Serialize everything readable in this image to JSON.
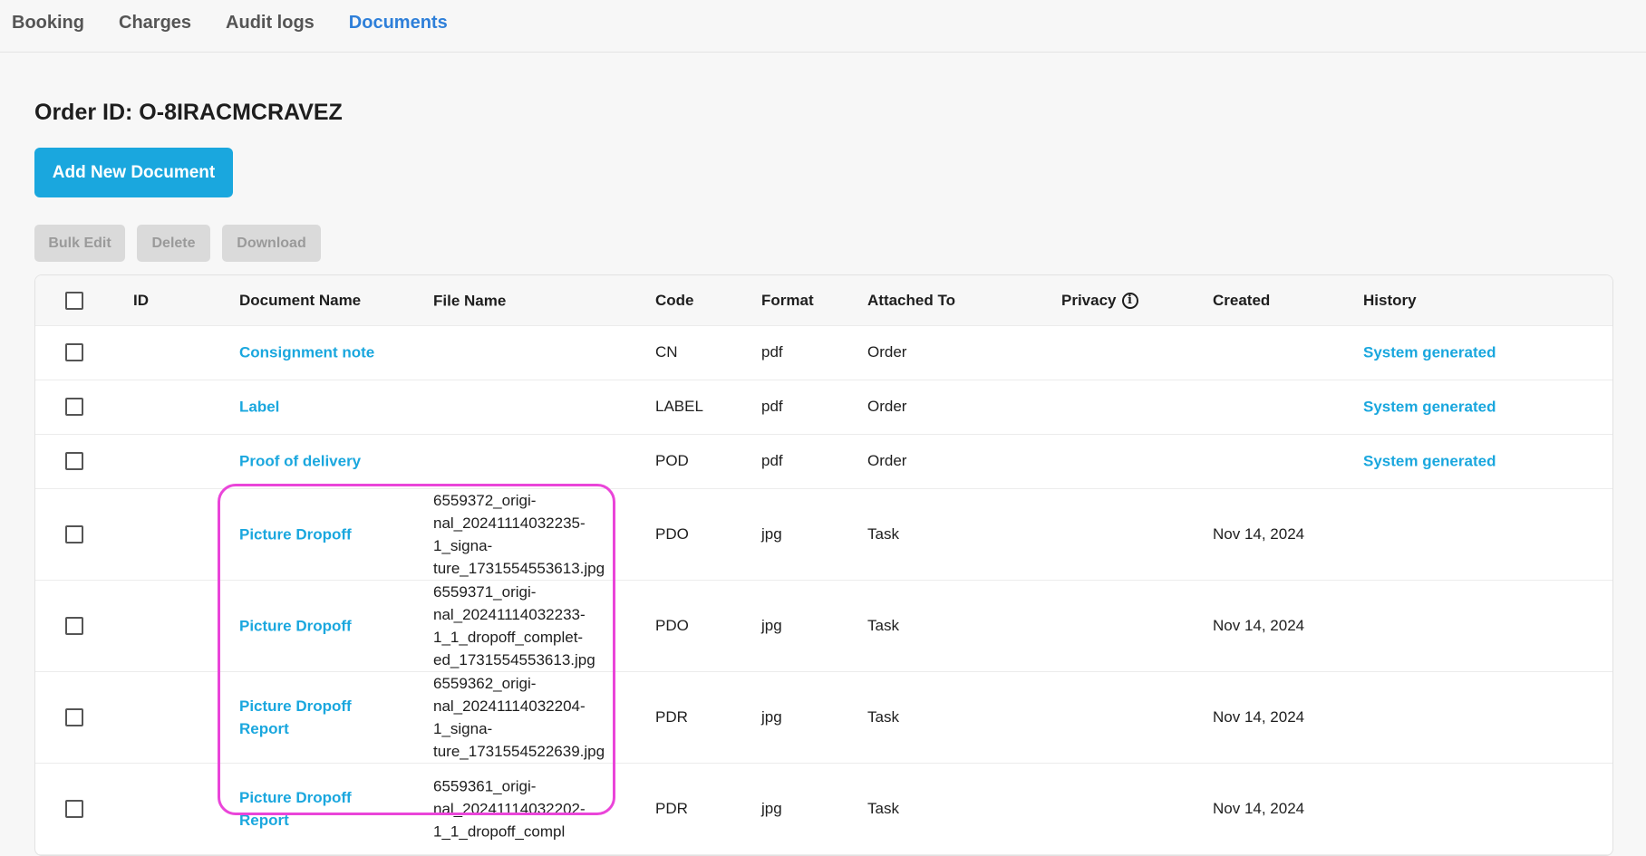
{
  "tabs": [
    "Booking",
    "Charges",
    "Audit logs",
    "Documents"
  ],
  "order_title": "Order ID: O-8IRACMCRAVEZ",
  "add_button": "Add New Document",
  "bulk": {
    "edit": "Bulk Edit",
    "delete": "Delete",
    "download": "Download"
  },
  "columns": {
    "id": "ID",
    "document_name": "Document Name",
    "file_name": "File Name",
    "code": "Code",
    "format": "Format",
    "attached_to": "Attached To",
    "privacy": "Privacy",
    "created": "Created",
    "history": "History"
  },
  "rows": [
    {
      "document_name": "Consignment note",
      "file_name": "",
      "code": "CN",
      "format": "pdf",
      "attached_to": "Order",
      "created": "",
      "history": "System generated"
    },
    {
      "document_name": "Label",
      "file_name": "",
      "code": "LABEL",
      "format": "pdf",
      "attached_to": "Order",
      "created": "",
      "history": "System generated"
    },
    {
      "document_name": "Proof of delivery",
      "file_name": "",
      "code": "POD",
      "format": "pdf",
      "attached_to": "Order",
      "created": "",
      "history": "System generated"
    },
    {
      "document_name": "Picture Dropoff",
      "file_name": "6559372_origi-nal_20241114032235-1_signa-ture_1731554553613.jpg",
      "code": "PDO",
      "format": "jpg",
      "attached_to": "Task",
      "created": "Nov 14, 2024",
      "history": ""
    },
    {
      "document_name": "Picture Dropoff",
      "file_name": "6559371_origi-nal_20241114032233-1_1_dropoff_complet-ed_1731554553613.jpg",
      "code": "PDO",
      "format": "jpg",
      "attached_to": "Task",
      "created": "Nov 14, 2024",
      "history": ""
    },
    {
      "document_name": "Picture Dropoff Report",
      "file_name": "6559362_origi-nal_20241114032204-1_signa-ture_1731554522639.jpg",
      "code": "PDR",
      "format": "jpg",
      "attached_to": "Task",
      "created": "Nov 14, 2024",
      "history": ""
    },
    {
      "document_name": "Picture Dropoff Report",
      "file_name": "6559361_origi-nal_20241114032202-1_1_dropoff_compl",
      "code": "PDR",
      "format": "jpg",
      "attached_to": "Task",
      "created": "Nov 14, 2024",
      "history": ""
    }
  ]
}
